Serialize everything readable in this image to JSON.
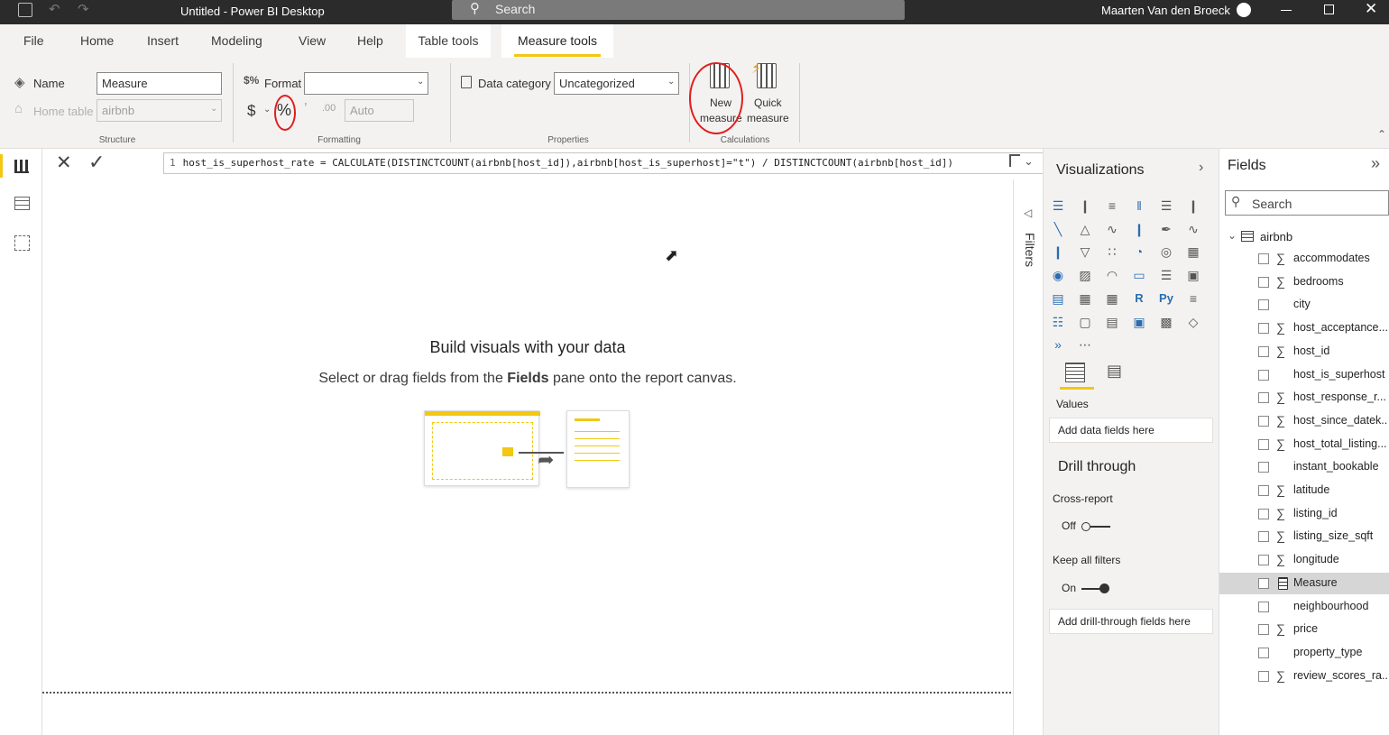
{
  "titlebar": {
    "title": "Untitled - Power BI Desktop",
    "search_placeholder": "Search",
    "user": "Maarten Van den Broeck"
  },
  "ribbon_tabs": [
    "File",
    "Home",
    "Insert",
    "Modeling",
    "View",
    "Help",
    "Table tools",
    "Measure tools"
  ],
  "structure": {
    "name_label": "Name",
    "name_value": "Measure",
    "home_table_label": "Home table",
    "home_table_value": "airbnb",
    "group": "Structure"
  },
  "formatting": {
    "format_label": "Format",
    "format_value": "",
    "currency": "$",
    "percent": "%",
    "comma": "9",
    "decimals_value": "Auto",
    "group": "Formatting"
  },
  "properties": {
    "data_category_label": "Data category",
    "data_category_value": "Uncategorized",
    "group": "Properties"
  },
  "calculations": {
    "new_measure": "New measure",
    "new_measure_l1": "New",
    "new_measure_l2": "measure",
    "quick_measure_l1": "Quick",
    "quick_measure_l2": "measure",
    "group": "Calculations"
  },
  "formula": {
    "line": "1",
    "text": "host_is_superhost_rate = CALCULATE(DISTINCTCOUNT(airbnb[host_id]),airbnb[host_is_superhost]=\"t\") / DISTINCTCOUNT(airbnb[host_id])"
  },
  "canvas": {
    "heading": "Build visuals with your data",
    "sub_pre": "Select or drag fields from the ",
    "sub_bold": "Fields",
    "sub_post": " pane onto the report canvas."
  },
  "filters_label": "Filters",
  "viz": {
    "title": "Visualizations",
    "values_label": "Values",
    "values_drop": "Add data fields here",
    "drill_title": "Drill through",
    "cross_report": "Cross-report",
    "off": "Off",
    "keep_filters": "Keep all filters",
    "on": "On",
    "drill_drop": "Add drill-through fields here"
  },
  "fields": {
    "title": "Fields",
    "search_placeholder": "Search",
    "table": "airbnb",
    "items": [
      {
        "name": "accommodates",
        "sigma": true
      },
      {
        "name": "bedrooms",
        "sigma": true
      },
      {
        "name": "city",
        "sigma": false
      },
      {
        "name": "host_acceptance...",
        "sigma": true
      },
      {
        "name": "host_id",
        "sigma": true
      },
      {
        "name": "host_is_superhost",
        "sigma": false
      },
      {
        "name": "host_response_r...",
        "sigma": true
      },
      {
        "name": "host_since_datek...",
        "sigma": true
      },
      {
        "name": "host_total_listing...",
        "sigma": true
      },
      {
        "name": "instant_bookable",
        "sigma": false
      },
      {
        "name": "latitude",
        "sigma": true
      },
      {
        "name": "listing_id",
        "sigma": true
      },
      {
        "name": "listing_size_sqft",
        "sigma": true
      },
      {
        "name": "longitude",
        "sigma": true
      },
      {
        "name": "Measure",
        "sigma": false,
        "measure": true
      },
      {
        "name": "neighbourhood",
        "sigma": false
      },
      {
        "name": "price",
        "sigma": true
      },
      {
        "name": "property_type",
        "sigma": false
      },
      {
        "name": "review_scores_ra...",
        "sigma": true
      }
    ]
  },
  "colors": {
    "accent": "#f2c811",
    "annotation": "#e01e1e",
    "titlebar": "#2b2b2b"
  }
}
